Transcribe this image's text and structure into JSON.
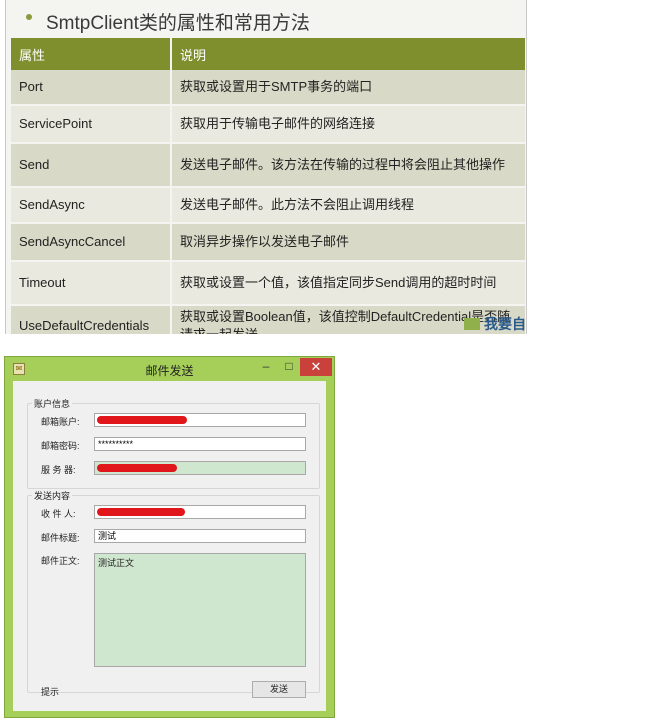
{
  "slide": {
    "title": "SmtpClient类的属性和常用方法",
    "headers": [
      "属性",
      "说明"
    ],
    "rows": [
      {
        "name": "Port",
        "desc": "获取或设置用于SMTP事务的端口"
      },
      {
        "name": "ServicePoint",
        "desc": "获取用于传输电子邮件的网络连接"
      },
      {
        "name": "Send",
        "desc": "发送电子邮件。该方法在传输的过程中将会阻止其他操作"
      },
      {
        "name": "SendAsync",
        "desc": "发送电子邮件。此方法不会阻止调用线程"
      },
      {
        "name": "SendAsyncCancel",
        "desc": "取消异步操作以发送电子邮件"
      },
      {
        "name": "Timeout",
        "desc": "获取或设置一个值，该值指定同步Send调用的超时时间"
      },
      {
        "name": "UseDefaultCredentials",
        "desc": "获取或设置Boolean值，该值控制DefaultCredential是否随请求一起发送"
      }
    ],
    "watermark": "我要自"
  },
  "window": {
    "title": "邮件发送",
    "icon": "mail-app-icon",
    "minimize_glyph": "–",
    "maximize_glyph": "□",
    "close_glyph": "✕",
    "account_group": "账户信息",
    "account_label": "邮箱账户:",
    "password_label": "邮箱密码:",
    "password_value": "**********",
    "server_label": "服 务 器:",
    "content_group": "发送内容",
    "recipient_label": "收 件 人:",
    "subject_label": "邮件标题:",
    "subject_value": "测试",
    "body_label": "邮件正文:",
    "body_value": "测试正文",
    "hint_label": "提示",
    "send_button": "发送"
  },
  "colors": {
    "header_bg": "#7f8f2e",
    "window_frame": "#a6cf5a",
    "close_button": "#c9413a",
    "redaction": "#e0161b"
  }
}
